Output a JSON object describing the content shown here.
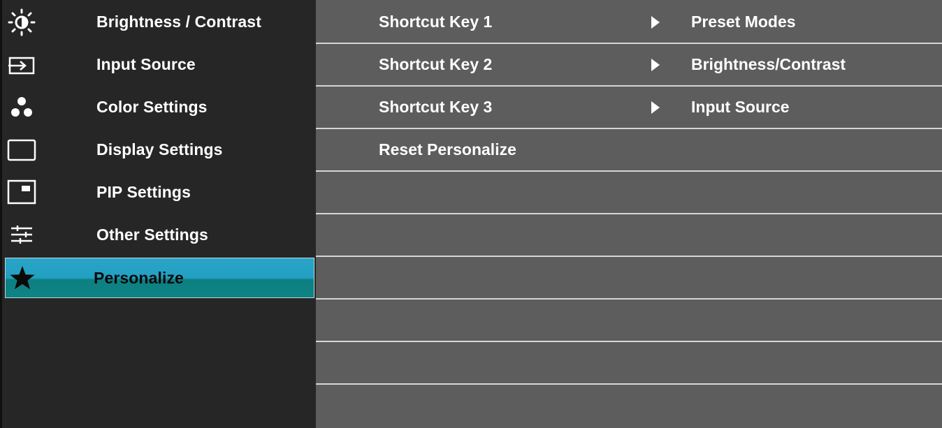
{
  "menu": {
    "items": [
      {
        "label": "Brightness / Contrast",
        "icon": "brightness-icon"
      },
      {
        "label": "Input Source",
        "icon": "input-source-icon"
      },
      {
        "label": "Color Settings",
        "icon": "color-settings-icon"
      },
      {
        "label": "Display Settings",
        "icon": "display-settings-icon"
      },
      {
        "label": "PIP Settings",
        "icon": "pip-settings-icon"
      },
      {
        "label": "Other Settings",
        "icon": "other-settings-icon"
      },
      {
        "label": "Personalize",
        "icon": "star-icon",
        "selected": true
      }
    ]
  },
  "submenu": {
    "rows": [
      {
        "label": "Shortcut Key 1",
        "value": "Preset Modes"
      },
      {
        "label": "Shortcut Key 2",
        "value": "Brightness/Contrast"
      },
      {
        "label": "Shortcut Key 3",
        "value": "Input Source"
      },
      {
        "label": "Reset Personalize",
        "value": ""
      },
      {
        "label": "",
        "value": ""
      },
      {
        "label": "",
        "value": ""
      },
      {
        "label": "",
        "value": ""
      },
      {
        "label": "",
        "value": ""
      },
      {
        "label": "",
        "value": ""
      },
      {
        "label": "",
        "value": ""
      }
    ]
  },
  "colors": {
    "selected_top": "#2aa3c6",
    "selected_bottom": "#0f8484",
    "panel_bg": "#5d5d5d",
    "menu_bg": "#262626"
  }
}
